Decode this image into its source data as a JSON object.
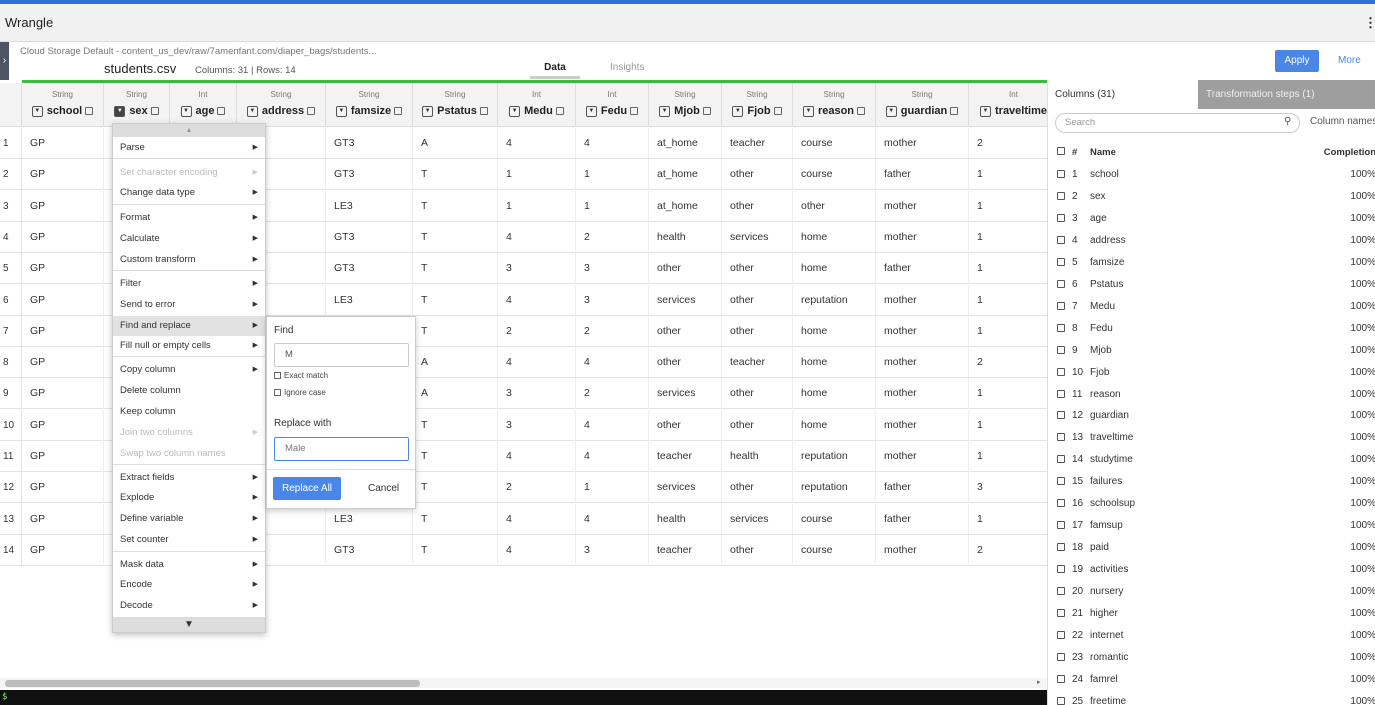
{
  "app": {
    "title": "Wrangle"
  },
  "file": {
    "breadcrumb": "Cloud Storage Default - content_us_dev/raw/7amenfant.com/diaper_bags/students...",
    "name": "students.csv",
    "meta": "Columns: 31 | Rows: 14"
  },
  "tabs": {
    "data": "Data",
    "insights": "Insights"
  },
  "actions": {
    "apply": "Apply",
    "more": "More"
  },
  "columns": [
    {
      "type": "String",
      "name": "school"
    },
    {
      "type": "String",
      "name": "sex"
    },
    {
      "type": "Int",
      "name": "age"
    },
    {
      "type": "String",
      "name": "address"
    },
    {
      "type": "String",
      "name": "famsize"
    },
    {
      "type": "String",
      "name": "Pstatus"
    },
    {
      "type": "Int",
      "name": "Medu"
    },
    {
      "type": "Int",
      "name": "Fedu"
    },
    {
      "type": "String",
      "name": "Mjob"
    },
    {
      "type": "String",
      "name": "Fjob"
    },
    {
      "type": "String",
      "name": "reason"
    },
    {
      "type": "String",
      "name": "guardian"
    },
    {
      "type": "Int",
      "name": "traveltime"
    }
  ],
  "rows": [
    {
      "n": "1",
      "school": "GP",
      "famsize": "GT3",
      "Pstatus": "A",
      "Medu": "4",
      "Fedu": "4",
      "Mjob": "at_home",
      "Fjob": "teacher",
      "reason": "course",
      "guardian": "mother",
      "traveltime": "2"
    },
    {
      "n": "2",
      "school": "GP",
      "famsize": "GT3",
      "Pstatus": "T",
      "Medu": "1",
      "Fedu": "1",
      "Mjob": "at_home",
      "Fjob": "other",
      "reason": "course",
      "guardian": "father",
      "traveltime": "1"
    },
    {
      "n": "3",
      "school": "GP",
      "famsize": "LE3",
      "Pstatus": "T",
      "Medu": "1",
      "Fedu": "1",
      "Mjob": "at_home",
      "Fjob": "other",
      "reason": "other",
      "guardian": "mother",
      "traveltime": "1"
    },
    {
      "n": "4",
      "school": "GP",
      "famsize": "GT3",
      "Pstatus": "T",
      "Medu": "4",
      "Fedu": "2",
      "Mjob": "health",
      "Fjob": "services",
      "reason": "home",
      "guardian": "mother",
      "traveltime": "1"
    },
    {
      "n": "5",
      "school": "GP",
      "famsize": "GT3",
      "Pstatus": "T",
      "Medu": "3",
      "Fedu": "3",
      "Mjob": "other",
      "Fjob": "other",
      "reason": "home",
      "guardian": "father",
      "traveltime": "1"
    },
    {
      "n": "6",
      "school": "GP",
      "famsize": "LE3",
      "Pstatus": "T",
      "Medu": "4",
      "Fedu": "3",
      "Mjob": "services",
      "Fjob": "other",
      "reason": "reputation",
      "guardian": "mother",
      "traveltime": "1"
    },
    {
      "n": "7",
      "school": "GP",
      "famsize": "",
      "Pstatus": "T",
      "Medu": "2",
      "Fedu": "2",
      "Mjob": "other",
      "Fjob": "other",
      "reason": "home",
      "guardian": "mother",
      "traveltime": "1"
    },
    {
      "n": "8",
      "school": "GP",
      "famsize": "",
      "Pstatus": "A",
      "Medu": "4",
      "Fedu": "4",
      "Mjob": "other",
      "Fjob": "teacher",
      "reason": "home",
      "guardian": "mother",
      "traveltime": "2"
    },
    {
      "n": "9",
      "school": "GP",
      "famsize": "",
      "Pstatus": "A",
      "Medu": "3",
      "Fedu": "2",
      "Mjob": "services",
      "Fjob": "other",
      "reason": "home",
      "guardian": "mother",
      "traveltime": "1"
    },
    {
      "n": "10",
      "school": "GP",
      "famsize": "",
      "Pstatus": "T",
      "Medu": "3",
      "Fedu": "4",
      "Mjob": "other",
      "Fjob": "other",
      "reason": "home",
      "guardian": "mother",
      "traveltime": "1"
    },
    {
      "n": "11",
      "school": "GP",
      "famsize": "",
      "Pstatus": "T",
      "Medu": "4",
      "Fedu": "4",
      "Mjob": "teacher",
      "Fjob": "health",
      "reason": "reputation",
      "guardian": "mother",
      "traveltime": "1"
    },
    {
      "n": "12",
      "school": "GP",
      "famsize": "",
      "Pstatus": "T",
      "Medu": "2",
      "Fedu": "1",
      "Mjob": "services",
      "Fjob": "other",
      "reason": "reputation",
      "guardian": "father",
      "traveltime": "3"
    },
    {
      "n": "13",
      "school": "GP",
      "famsize": "LE3",
      "Pstatus": "T",
      "Medu": "4",
      "Fedu": "4",
      "Mjob": "health",
      "Fjob": "services",
      "reason": "course",
      "guardian": "father",
      "traveltime": "1"
    },
    {
      "n": "14",
      "school": "GP",
      "famsize": "GT3",
      "Pstatus": "T",
      "Medu": "4",
      "Fedu": "3",
      "Mjob": "teacher",
      "Fjob": "other",
      "reason": "course",
      "guardian": "mother",
      "traveltime": "2"
    }
  ],
  "context_menu": {
    "items": [
      {
        "label": "Parse",
        "disabled": false,
        "submenu": true
      },
      {
        "label": "Set character encoding",
        "disabled": true,
        "submenu": true
      },
      {
        "label": "Change data type",
        "disabled": false,
        "submenu": true
      },
      {
        "label": "Format",
        "disabled": false,
        "submenu": true
      },
      {
        "label": "Calculate",
        "disabled": false,
        "submenu": true
      },
      {
        "label": "Custom transform",
        "disabled": false,
        "submenu": true
      },
      {
        "label": "Filter",
        "disabled": false,
        "submenu": true
      },
      {
        "label": "Send to error",
        "disabled": false,
        "submenu": true
      },
      {
        "label": "Find and replace",
        "disabled": false,
        "submenu": true,
        "highlighted": true
      },
      {
        "label": "Fill null or empty cells",
        "disabled": false,
        "submenu": true
      },
      {
        "label": "Copy column",
        "disabled": false,
        "submenu": true
      },
      {
        "label": "Delete column",
        "disabled": false,
        "submenu": false
      },
      {
        "label": "Keep column",
        "disabled": false,
        "submenu": false
      },
      {
        "label": "Join two columns",
        "disabled": true,
        "submenu": true
      },
      {
        "label": "Swap two column names",
        "disabled": true,
        "submenu": false
      },
      {
        "label": "Extract fields",
        "disabled": false,
        "submenu": true
      },
      {
        "label": "Explode",
        "disabled": false,
        "submenu": true
      },
      {
        "label": "Define variable",
        "disabled": false,
        "submenu": true
      },
      {
        "label": "Set counter",
        "disabled": false,
        "submenu": true
      },
      {
        "label": "Mask data",
        "disabled": false,
        "submenu": true
      },
      {
        "label": "Encode",
        "disabled": false,
        "submenu": true
      },
      {
        "label": "Decode",
        "disabled": false,
        "submenu": true
      }
    ]
  },
  "find_replace": {
    "find_label": "Find",
    "find_value": "M",
    "exact_match": "Exact match",
    "ignore_case": "Ignore case",
    "replace_label": "Replace with",
    "replace_value": "Male",
    "replace_all": "Replace All",
    "cancel": "Cancel"
  },
  "sidepanel": {
    "tab_columns": "Columns (31)",
    "tab_steps": "Transformation steps (1)",
    "search_placeholder": "Search",
    "column_names_toggle": "Column names",
    "head_num": "#",
    "head_name": "Name",
    "head_completion": "Completion",
    "columns": [
      {
        "n": "1",
        "name": "school",
        "completion": "100%"
      },
      {
        "n": "2",
        "name": "sex",
        "completion": "100%"
      },
      {
        "n": "3",
        "name": "age",
        "completion": "100%"
      },
      {
        "n": "4",
        "name": "address",
        "completion": "100%"
      },
      {
        "n": "5",
        "name": "famsize",
        "completion": "100%"
      },
      {
        "n": "6",
        "name": "Pstatus",
        "completion": "100%"
      },
      {
        "n": "7",
        "name": "Medu",
        "completion": "100%"
      },
      {
        "n": "8",
        "name": "Fedu",
        "completion": "100%"
      },
      {
        "n": "9",
        "name": "Mjob",
        "completion": "100%"
      },
      {
        "n": "10",
        "name": "Fjob",
        "completion": "100%"
      },
      {
        "n": "11",
        "name": "reason",
        "completion": "100%"
      },
      {
        "n": "12",
        "name": "guardian",
        "completion": "100%"
      },
      {
        "n": "13",
        "name": "traveltime",
        "completion": "100%"
      },
      {
        "n": "14",
        "name": "studytime",
        "completion": "100%"
      },
      {
        "n": "15",
        "name": "failures",
        "completion": "100%"
      },
      {
        "n": "16",
        "name": "schoolsup",
        "completion": "100%"
      },
      {
        "n": "17",
        "name": "famsup",
        "completion": "100%"
      },
      {
        "n": "18",
        "name": "paid",
        "completion": "100%"
      },
      {
        "n": "19",
        "name": "activities",
        "completion": "100%"
      },
      {
        "n": "20",
        "name": "nursery",
        "completion": "100%"
      },
      {
        "n": "21",
        "name": "higher",
        "completion": "100%"
      },
      {
        "n": "22",
        "name": "internet",
        "completion": "100%"
      },
      {
        "n": "23",
        "name": "romantic",
        "completion": "100%"
      },
      {
        "n": "24",
        "name": "famrel",
        "completion": "100%"
      },
      {
        "n": "25",
        "name": "freetime",
        "completion": "100%"
      }
    ]
  },
  "terminal": {
    "prompt": "$"
  }
}
